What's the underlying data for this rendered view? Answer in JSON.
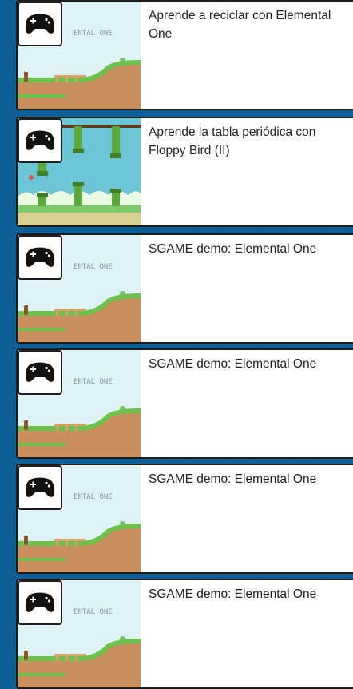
{
  "games": [
    {
      "title": "Aprende a reciclar con Elemental One",
      "thumb": "elemental-one",
      "thumb_text": "ENTAL ONE"
    },
    {
      "title": "Aprende la tabla periódica con Floppy Bird (II)",
      "thumb": "floppy-bird",
      "thumb_text": ""
    },
    {
      "title": "SGAME demo: Elemental One",
      "thumb": "elemental-one",
      "thumb_text": "ENTAL ONE"
    },
    {
      "title": "SGAME demo: Elemental One",
      "thumb": "elemental-one",
      "thumb_text": "ENTAL ONE"
    },
    {
      "title": "SGAME demo: Elemental One",
      "thumb": "elemental-one",
      "thumb_text": "ENTAL ONE"
    },
    {
      "title": "SGAME demo: Elemental One",
      "thumb": "elemental-one",
      "thumb_text": "ENTAL ONE"
    }
  ],
  "icons": {
    "badge": "gamepad-icon"
  },
  "colors": {
    "background": "#0e5f95",
    "sky": "#dff3f7",
    "grass": "#6cc24a",
    "dirt": "#c98f5e",
    "pipe": "#5aa83a"
  }
}
